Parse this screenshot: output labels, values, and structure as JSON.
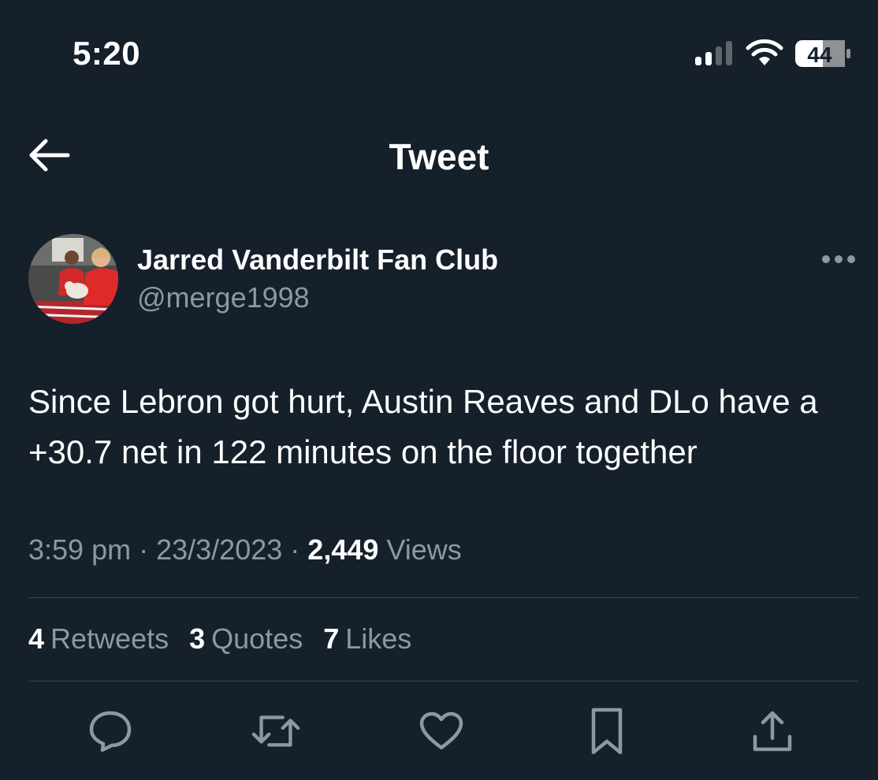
{
  "status_bar": {
    "time": "5:20",
    "battery_level": "44"
  },
  "nav": {
    "title": "Tweet"
  },
  "author": {
    "name": "Jarred Vanderbilt Fan Club",
    "handle": "@merge1998"
  },
  "tweet": {
    "text": "Since Lebron got hurt, Austin Reaves and DLo have a +30.7 net in 122 minutes on the floor together",
    "time": "3:59 pm",
    "date": "23/3/2023",
    "views_count": "2,449",
    "views_label": "Views",
    "separator": "·"
  },
  "stats": {
    "retweets_count": "4",
    "retweets_label": "Retweets",
    "quotes_count": "3",
    "quotes_label": "Quotes",
    "likes_count": "7",
    "likes_label": "Likes"
  },
  "icons": {
    "back": "arrow-left-icon",
    "more": "more-horizontal-icon",
    "reply": "reply-icon",
    "retweet": "retweet-icon",
    "like": "heart-icon",
    "bookmark": "bookmark-icon",
    "share": "share-icon"
  },
  "colors": {
    "background": "#15202b",
    "secondary_text": "#8b98a5",
    "divider": "#38444d"
  }
}
